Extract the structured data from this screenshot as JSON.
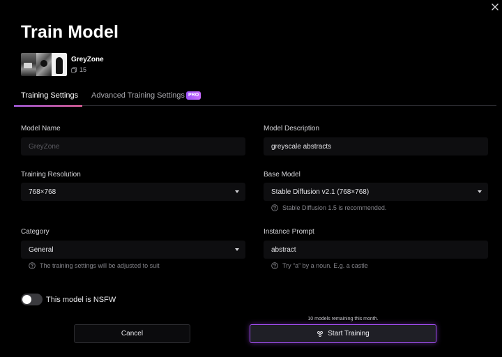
{
  "dialog": {
    "title": "Train Model",
    "close_icon": "close-icon"
  },
  "dataset": {
    "name": "GreyZone",
    "count": "15",
    "count_icon": "copy-icon"
  },
  "tabs": [
    {
      "label": "Training Settings",
      "active": true
    },
    {
      "label": "Advanced Training Settings",
      "active": false,
      "badge": "PRO"
    }
  ],
  "form": {
    "model_name": {
      "label": "Model Name",
      "value": "",
      "placeholder": "GreyZone"
    },
    "model_description": {
      "label": "Model Description",
      "value": "greyscale abstracts"
    },
    "training_resolution": {
      "label": "Training Resolution",
      "value": "768×768"
    },
    "base_model": {
      "label": "Base Model",
      "value": "Stable Diffusion v2.1 (768×768)",
      "hint": "Stable Diffusion 1.5 is recommended."
    },
    "category": {
      "label": "Category",
      "value": "General",
      "hint": "The training settings will be adjusted to suit"
    },
    "instance_prompt": {
      "label": "Instance Prompt",
      "value": "abstract",
      "hint": "Try “a” by a noun. E.g. a castle"
    }
  },
  "nsfw": {
    "label": "This model is NSFW",
    "on": false
  },
  "footer": {
    "remaining": "10 models remaining this month.",
    "cancel_label": "Cancel",
    "start_label": "Start Training",
    "start_icon": "sparkle-icon"
  },
  "colors": {
    "accent": "#a14cf0",
    "tab_underline_start": "#c06bff",
    "tab_underline_end": "#ff6fb1",
    "background": "#000000",
    "field_bg": "#0e0e10"
  }
}
